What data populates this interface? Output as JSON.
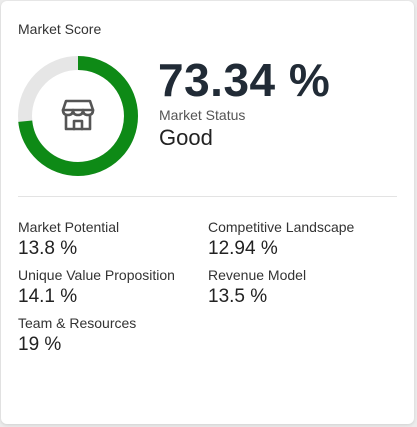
{
  "card": {
    "title": "Market Score"
  },
  "score": {
    "value": "73.34 %",
    "progress_fraction": 0.7334,
    "ring_color": "#0e8a16",
    "track_color": "#e6e6e6",
    "icon": "store-icon",
    "status_label": "Market Status",
    "status_value": "Good"
  },
  "metrics": [
    {
      "label": "Market Potential",
      "value": "13.8 %"
    },
    {
      "label": "Competitive Landscape",
      "value": "12.94 %"
    },
    {
      "label": "Unique Value Proposition",
      "value": "14.1 %"
    },
    {
      "label": "Revenue Model",
      "value": "13.5 %"
    },
    {
      "label": "Team & Resources",
      "value": "19 %"
    }
  ]
}
